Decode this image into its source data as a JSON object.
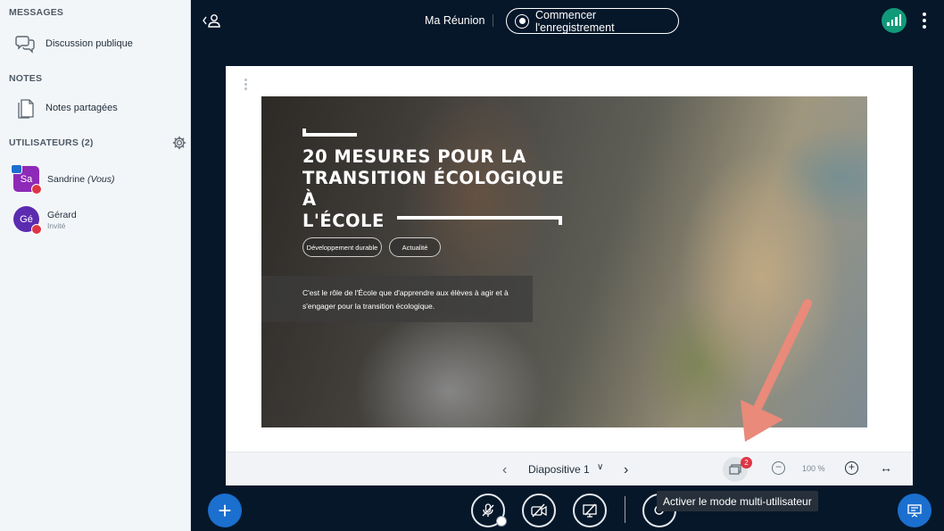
{
  "sidebar": {
    "messages_title": "MESSAGES",
    "public_chat_label": "Discussion publique",
    "notes_title": "NOTES",
    "shared_notes_label": "Notes partagées",
    "users_title": "UTILISATEURS (2)",
    "users": [
      {
        "initials": "Sa",
        "name": "Sandrine",
        "suffix": "(Vous)",
        "role": "",
        "color": "#8e2ab8"
      },
      {
        "initials": "Gé",
        "name": "Gérard",
        "suffix": "",
        "role": "Invité",
        "color": "#5b2bb0"
      }
    ]
  },
  "topbar": {
    "meeting_title": "Ma Réunion",
    "record_label": "Commencer l'enregistrement"
  },
  "slide": {
    "title_lines": [
      "20 MESURES POUR LA",
      "TRANSITION ÉCOLOGIQUE À",
      "L'ÉCOLE"
    ],
    "tags": [
      "Développement durable",
      "Actualité"
    ],
    "description": "C'est le rôle de l'École que d'apprendre aux élèves à agir et à s'engager pour la transition écologique."
  },
  "pres_toolbar": {
    "slide_label": "Diapositive 1",
    "multi_user_badge": "2",
    "zoom": "100 %"
  },
  "tooltip": "Activer le mode multi-utilisateur",
  "colors": {
    "primary": "#1b6fce",
    "background": "#06172a",
    "connection": "#109a7a",
    "alert": "#de3545",
    "annotation_arrow": "#e98a7a"
  }
}
